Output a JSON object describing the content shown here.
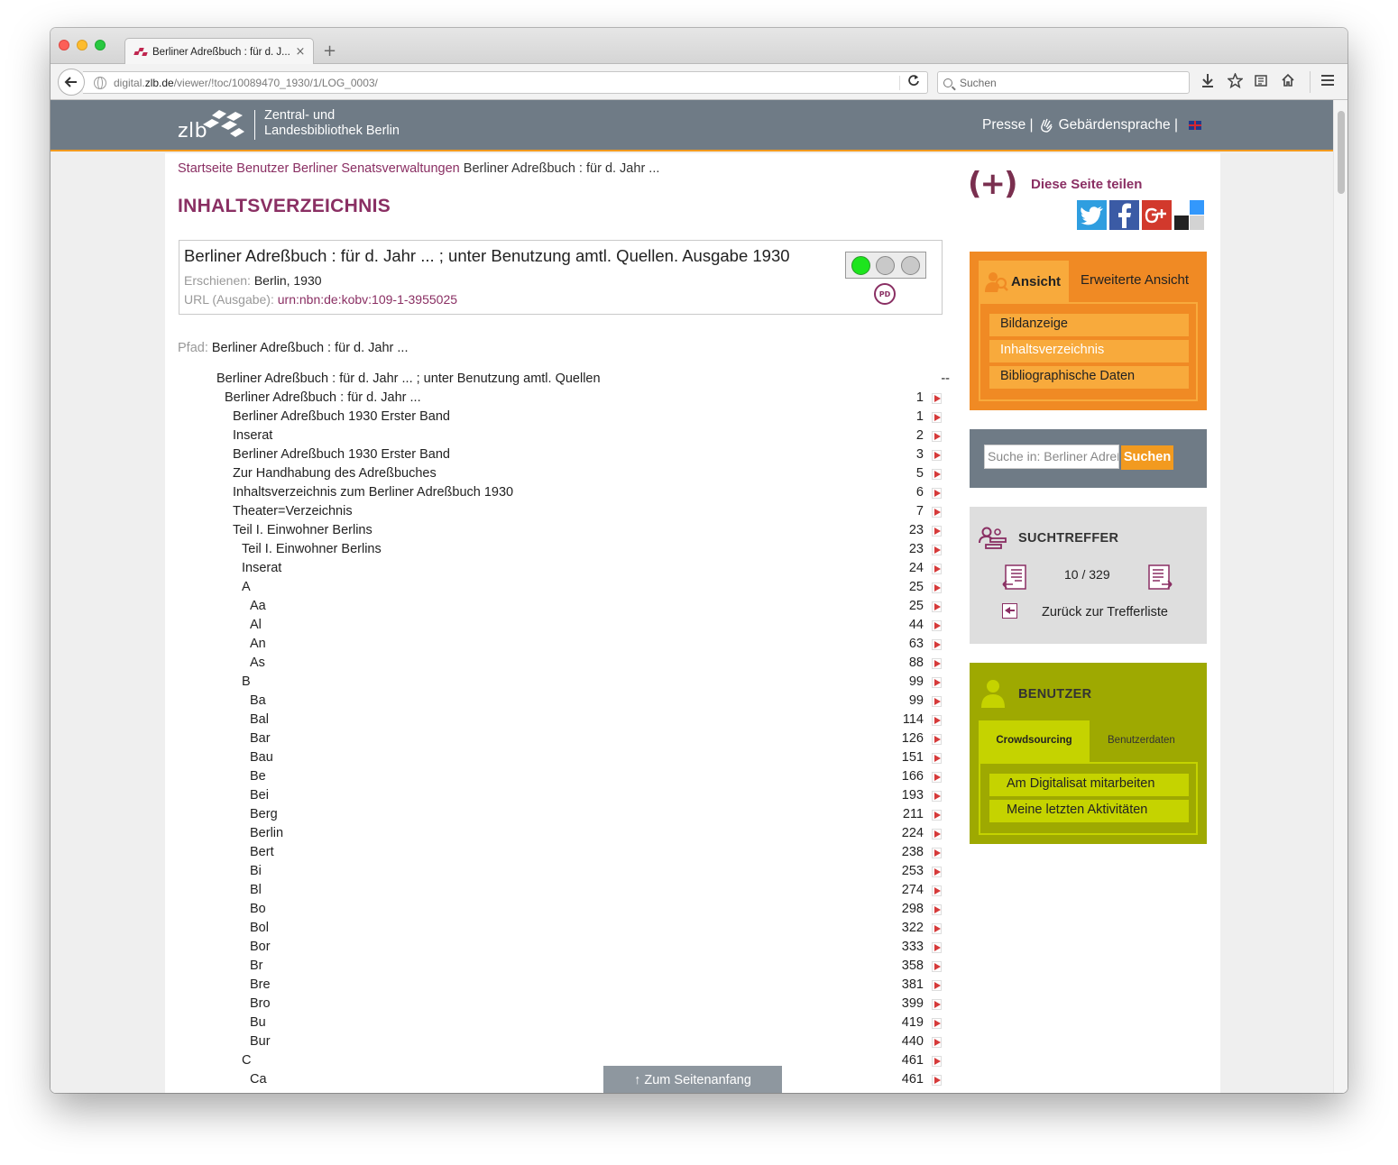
{
  "browser": {
    "tab_title": "Berliner Adreßbuch : für d. J...",
    "tab_close": "×",
    "new_tab": "+",
    "url_prefix": "digital.",
    "url_host": "zlb.de",
    "url_path": "/viewer/!toc/10089470_1930/1/LOG_0003/",
    "search_placeholder": "Suchen"
  },
  "header": {
    "logo_text": "zlb",
    "name_line1": "Zentral- und",
    "name_line2": "Landesbibliothek Berlin",
    "link_presse": "Presse |",
    "link_sign": "Gebärdensprache |",
    "colors": {
      "bar": "#6f7b86",
      "accent": "#f29a1f",
      "brand": "#8a2f63"
    }
  },
  "breadcrumb": {
    "items": [
      "Startseite",
      "Benutzer",
      "Berliner Senatsverwaltungen"
    ],
    "current": "Berliner Adreßbuch : für d. Jahr ..."
  },
  "page_title": "INHALTSVERZEICHNIS",
  "record": {
    "title": "Berliner Adreßbuch : für d. Jahr ... ; unter Benutzung amtl. Quellen. Ausgabe 1930",
    "published_label": "Erschienen:",
    "published_value": "Berlin, 1930",
    "url_label": "URL (Ausgabe):",
    "url_value": "urn:nbn:de:kobv:109-1-3955025",
    "pd_badge": "PD"
  },
  "path": {
    "label": "Pfad:",
    "value": "Berliner Adreßbuch : für d. Jahr ..."
  },
  "toc": [
    {
      "label": "Berliner Adreßbuch : für d. Jahr ... ; unter Benutzung amtl. Quellen",
      "page": "--",
      "level": 0
    },
    {
      "label": "Berliner Adreßbuch : für d. Jahr ...",
      "page": "1",
      "level": 1
    },
    {
      "label": "Berliner Adreßbuch 1930 Erster Band",
      "page": "1",
      "level": 2
    },
    {
      "label": "Inserat",
      "page": "2",
      "level": 2
    },
    {
      "label": "Berliner Adreßbuch 1930 Erster Band",
      "page": "3",
      "level": 2
    },
    {
      "label": "Zur Handhabung des Adreßbuches",
      "page": "5",
      "level": 2
    },
    {
      "label": "Inhaltsverzeichnis zum Berliner Adreßbuch 1930",
      "page": "6",
      "level": 2
    },
    {
      "label": "Theater=Verzeichnis",
      "page": "7",
      "level": 2
    },
    {
      "label": "Teil I. Einwohner Berlins",
      "page": "23",
      "level": 2
    },
    {
      "label": "Teil I. Einwohner Berlins",
      "page": "23",
      "level": 3
    },
    {
      "label": "Inserat",
      "page": "24",
      "level": 3
    },
    {
      "label": "A",
      "page": "25",
      "level": 3
    },
    {
      "label": "Aa",
      "page": "25",
      "level": 4
    },
    {
      "label": "Al",
      "page": "44",
      "level": 4
    },
    {
      "label": "An",
      "page": "63",
      "level": 4
    },
    {
      "label": "As",
      "page": "88",
      "level": 4
    },
    {
      "label": "B",
      "page": "99",
      "level": 3
    },
    {
      "label": "Ba",
      "page": "99",
      "level": 4
    },
    {
      "label": "Bal",
      "page": "114",
      "level": 4
    },
    {
      "label": "Bar",
      "page": "126",
      "level": 4
    },
    {
      "label": "Bau",
      "page": "151",
      "level": 4
    },
    {
      "label": "Be",
      "page": "166",
      "level": 4
    },
    {
      "label": "Bei",
      "page": "193",
      "level": 4
    },
    {
      "label": "Berg",
      "page": "211",
      "level": 4
    },
    {
      "label": "Berlin",
      "page": "224",
      "level": 4
    },
    {
      "label": "Bert",
      "page": "238",
      "level": 4
    },
    {
      "label": "Bi",
      "page": "253",
      "level": 4
    },
    {
      "label": "Bl",
      "page": "274",
      "level": 4
    },
    {
      "label": "Bo",
      "page": "298",
      "level": 4
    },
    {
      "label": "Bol",
      "page": "322",
      "level": 4
    },
    {
      "label": "Bor",
      "page": "333",
      "level": 4
    },
    {
      "label": "Br",
      "page": "358",
      "level": 4
    },
    {
      "label": "Bre",
      "page": "381",
      "level": 4
    },
    {
      "label": "Bro",
      "page": "399",
      "level": 4
    },
    {
      "label": "Bu",
      "page": "419",
      "level": 4
    },
    {
      "label": "Bur",
      "page": "440",
      "level": 4
    },
    {
      "label": "C",
      "page": "461",
      "level": 3
    },
    {
      "label": "Ca",
      "page": "461",
      "level": 4
    }
  ],
  "back_to_top": "↑ Zum Seitenanfang",
  "sidebar": {
    "share_symbol": "(+)",
    "share_label": "Diese Seite teilen",
    "ansicht": {
      "tab_active": "Ansicht",
      "tab_other": "Erweiterte Ansicht",
      "items": [
        "Bildanzeige",
        "Inhaltsverzeichnis",
        "Bibliographische Daten"
      ],
      "active_index": 1
    },
    "search": {
      "placeholder": "Suche in: Berliner Adreßbuch",
      "button": "Suchen"
    },
    "hits": {
      "title": "SUCHTREFFER",
      "count": "10 / 329",
      "back_label": "Zurück zur Trefferliste"
    },
    "user": {
      "title": "BENUTZER",
      "tab_active": "Crowdsourcing",
      "tab_other": "Benutzerdaten",
      "items": [
        "Am Digitalisat mitarbeiten",
        "Meine letzten Aktivitäten"
      ]
    }
  }
}
